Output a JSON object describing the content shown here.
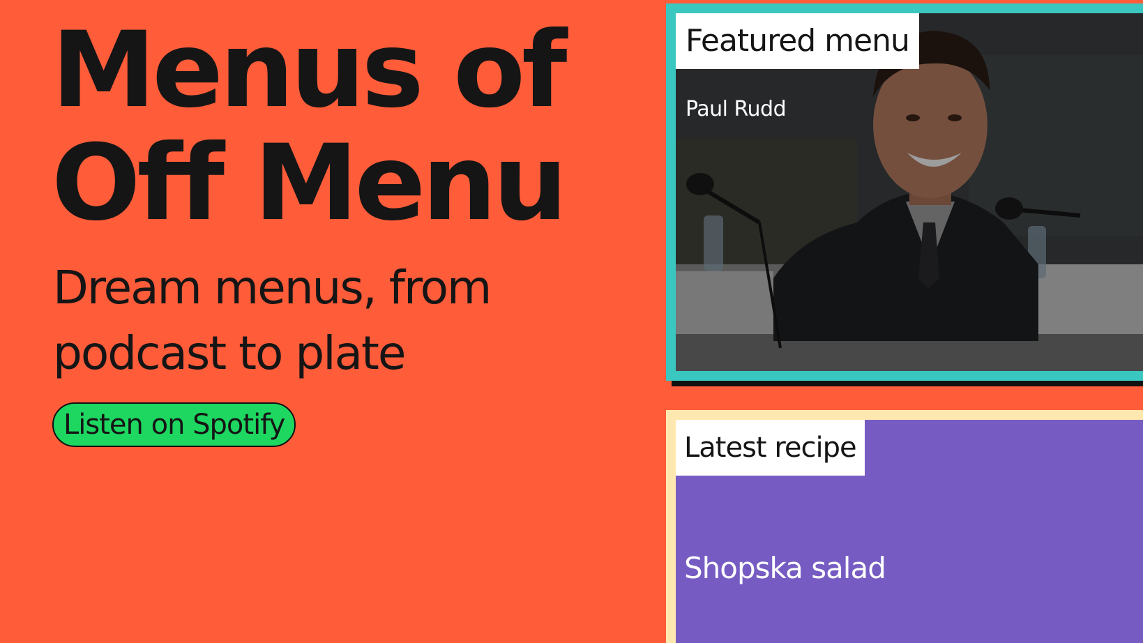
{
  "hero": {
    "title_line1": "Menus of",
    "title_line2": "Off Menu",
    "subtitle_line1": "Dream menus, from",
    "subtitle_line2": "podcast to plate",
    "cta_label": "Listen on Spotify"
  },
  "featured": {
    "tag": "Featured menu",
    "guest_name": "Paul Rudd",
    "image_icon": "guest-photo"
  },
  "recipe": {
    "tag": "Latest recipe",
    "name": "Shopska salad"
  },
  "colors": {
    "background": "#ff5c3a",
    "spotify_green": "#1ed760",
    "featured_border": "#3ac7c0",
    "recipe_border": "#ffe8b0",
    "recipe_background": "#765cc2"
  }
}
